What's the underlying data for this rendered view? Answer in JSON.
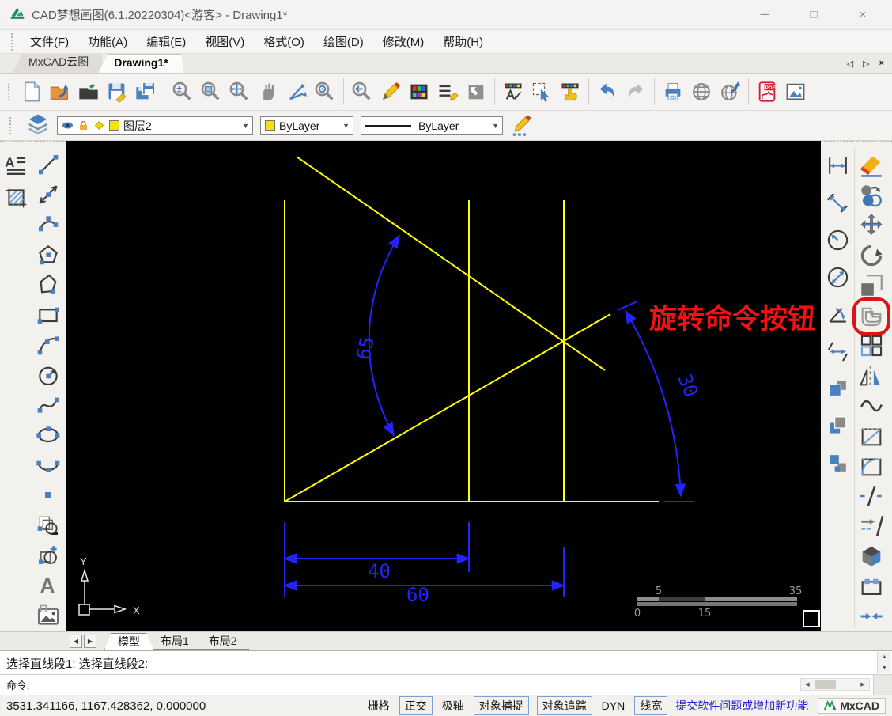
{
  "window": {
    "title": "CAD梦想画图(6.1.20220304)<游客> - Drawing1*",
    "controls": [
      {
        "name": "minimize",
        "glyph": "─"
      },
      {
        "name": "maximize",
        "glyph": "□"
      },
      {
        "name": "close",
        "glyph": "×"
      }
    ]
  },
  "menu": {
    "items": [
      "文件(F)",
      "功能(A)",
      "编辑(E)",
      "视图(V)",
      "格式(O)",
      "绘图(D)",
      "修改(M)",
      "帮助(H)"
    ]
  },
  "doc_tabs": {
    "tabs": [
      {
        "label": "MxCAD云图",
        "active": false
      },
      {
        "label": "Drawing1*",
        "active": true
      }
    ],
    "nav": [
      {
        "name": "tabs-prev",
        "glyph": "◁"
      },
      {
        "name": "tabs-next",
        "glyph": "▷"
      },
      {
        "name": "tabs-close",
        "glyph": "×"
      }
    ]
  },
  "toolbar": {
    "groups": [
      [
        "new-file",
        "open-web-folder",
        "open-folder",
        "save",
        "save-all"
      ],
      [
        "zoom-dynamic",
        "zoom-window",
        "zoom-extents",
        "pan-hand",
        "ucs-axes",
        "zoom-center"
      ],
      [
        "zoom-previous",
        "draw-pencil",
        "color-palette",
        "linetype-manager",
        "view-clip"
      ],
      [
        "text-style",
        "select-entity",
        "options-hand"
      ],
      [
        "undo",
        "redo"
      ],
      [
        "print",
        "web-globe",
        "publish-web"
      ],
      [
        "pdf-export",
        "image-file"
      ]
    ]
  },
  "layerbar": {
    "layer": {
      "value": "图层2"
    },
    "color": {
      "value": "ByLayer"
    },
    "linetype": {
      "value": "ByLayer"
    }
  },
  "left_tools": {
    "column_a": [
      "text-multiline",
      "hatch"
    ],
    "column_b": [
      "line",
      "construction-line",
      "arc",
      "polygon",
      "polygon-irregular",
      "rectangle",
      "arc-3point",
      "circle-radius",
      "spline",
      "ellipse",
      "ellipse-arc",
      "point",
      "block-copy",
      "block-insert",
      "text-single",
      "image-insert"
    ]
  },
  "right_tools": {
    "dim_column": [
      "dim-linear",
      "dim-aligned",
      "dim-radius",
      "dim-diameter",
      "dim-angular",
      "dim-continue",
      "draw-order-front",
      "draw-order-back",
      "draw-order-above"
    ],
    "modify_column": [
      "erase",
      "copy-object",
      "move",
      "rotate",
      "scale",
      "offset",
      "array",
      "mirror",
      "edit-spline",
      "chamfer",
      "fillet",
      "break",
      "extend",
      "explode",
      "stretch",
      "join"
    ],
    "highlighted_tool": "offset"
  },
  "canvas": {
    "annotation": "旋转命令按钮",
    "dims": {
      "d40": "40",
      "d60": "60"
    },
    "angles": {
      "a65": "65",
      "a30": "30"
    },
    "scale": {
      "five": "5",
      "thirtyfive": "35",
      "zero": "0",
      "fifteen": "15"
    },
    "ucs": {
      "x": "X",
      "y": "Y"
    }
  },
  "model_tabs": {
    "nav": [
      {
        "name": "model-prev",
        "glyph": "◀"
      },
      {
        "name": "model-next",
        "glyph": "▶"
      }
    ],
    "tabs": [
      {
        "label": "模型",
        "active": true
      },
      {
        "label": "布局1",
        "active": false
      },
      {
        "label": "布局2",
        "active": false
      }
    ]
  },
  "command": {
    "history": "选择直线段1: 选择直线段2:",
    "prompt": "命令:"
  },
  "status": {
    "coordinates": "3531.341166, 1167.428362, 0.000000",
    "toggles": [
      {
        "label": "栅格",
        "boxed": false
      },
      {
        "label": "正交",
        "boxed": true
      },
      {
        "label": "极轴",
        "boxed": false
      },
      {
        "label": "对象捕捉",
        "boxed": true
      },
      {
        "label": "对象追踪",
        "boxed": true
      },
      {
        "label": "DYN",
        "boxed": false
      },
      {
        "label": "线宽",
        "boxed": true
      }
    ],
    "link": "提交软件问题或增加新功能",
    "brand": "MxCAD"
  },
  "colors": {
    "accent_blue": "#2323ff",
    "draw_yellow": "#ffff00",
    "annotation_red": "#ee1212",
    "highlight_ring": "#dd1414"
  }
}
